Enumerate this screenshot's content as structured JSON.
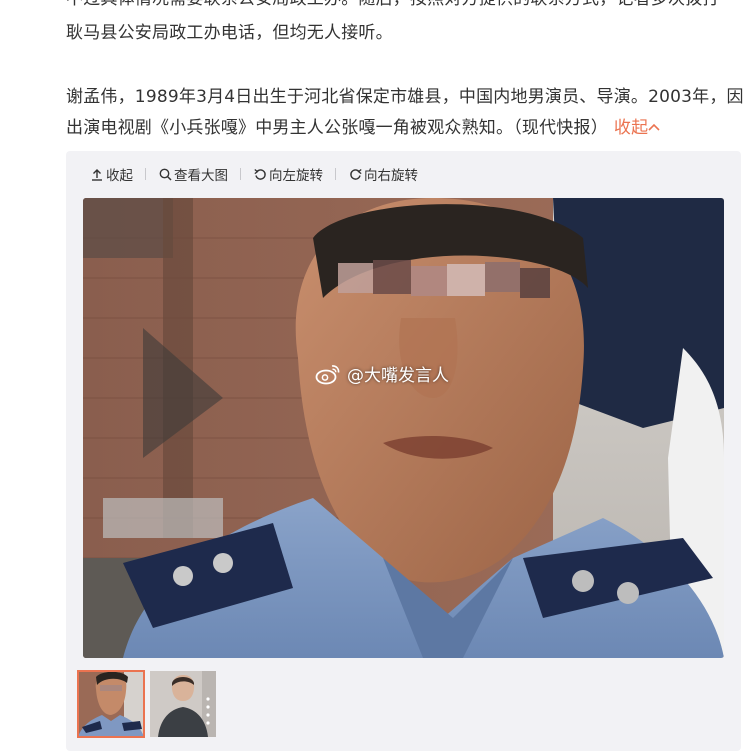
{
  "article": {
    "para1_line1": "不过具体情况需要联系公安局政工办。随后，按照对方提供的联系方式，记者多次拨打",
    "para1_line2": "耿马县公安局政工办电话，但均无人接听。",
    "para2_line1": "谢孟伟，1989年3月4日出生于河北省保定市雄县，中国内地男演员、导演。2003年，因",
    "para2_line2": "出演电视剧《小兵张嘎》中男主人公张嘎一角被观众熟知。（现代快报）",
    "collapse_label": "收起",
    "link_color": "#eb7350"
  },
  "toolbar": {
    "collapse": "收起",
    "view_large": "查看大图",
    "rotate_left": "向左旋转",
    "rotate_right": "向右旋转"
  },
  "image": {
    "watermark": "@大嘴发言人"
  },
  "thumbnails": [
    {
      "active": true,
      "icon": "police-officer-thumbnail"
    },
    {
      "active": false,
      "icon": "young-man-thumbnail"
    }
  ]
}
